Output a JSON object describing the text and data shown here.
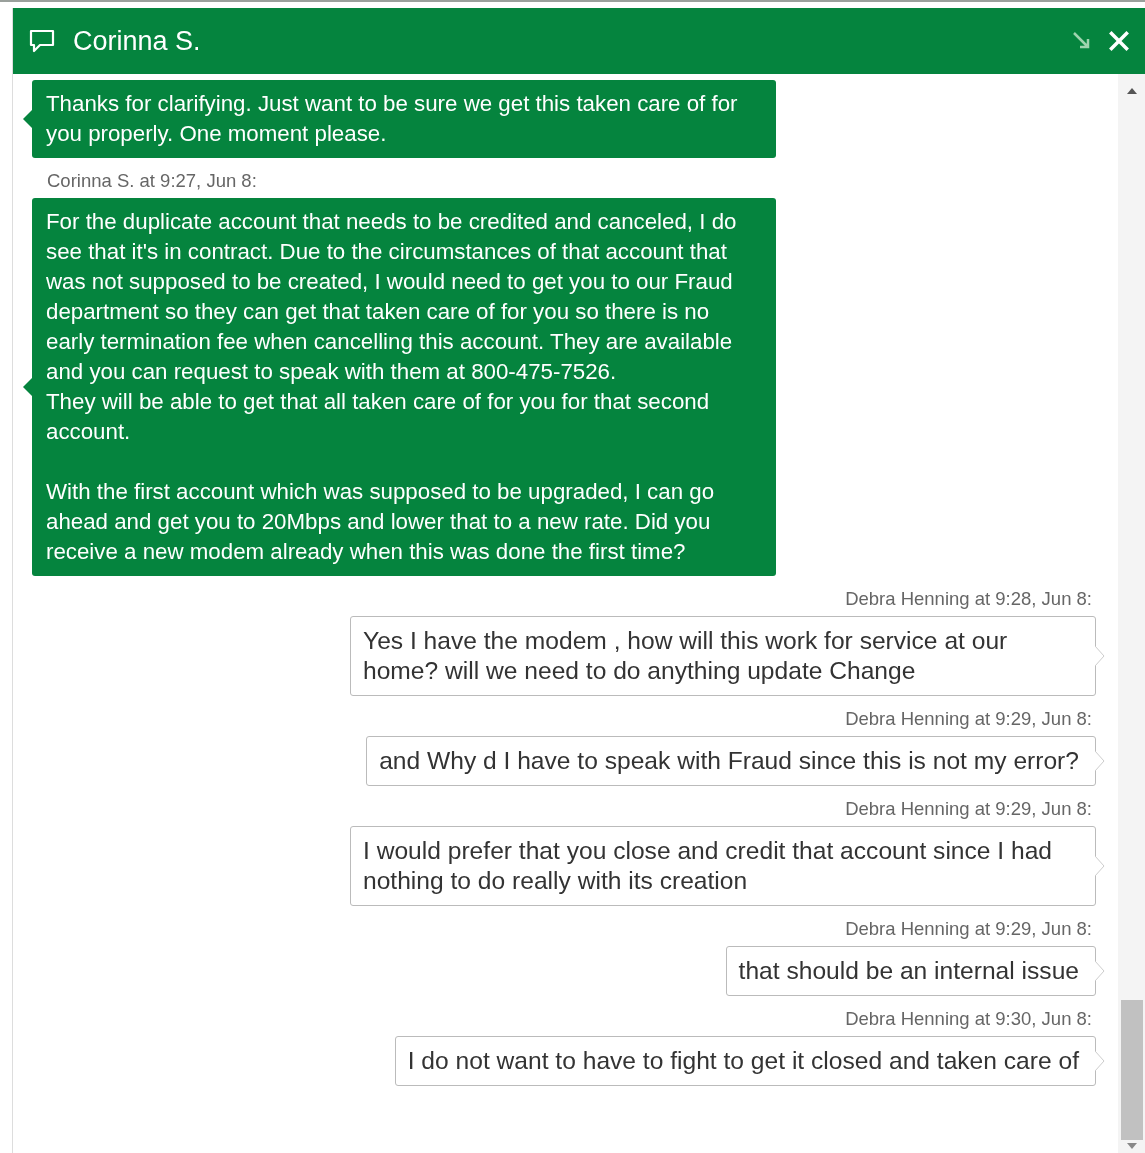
{
  "window": {
    "title": "Corinna S."
  },
  "messages": [
    {
      "kind": "agent",
      "text": "Thanks for clarifying. Just want to be sure we get this taken care of for you properly. One moment please."
    },
    {
      "kind": "agent",
      "meta": "Corinna S. at 9:27, Jun 8:",
      "text": "For the duplicate account that needs to be credited and canceled, I do see that it's in contract. Due to the circumstances of that account that was not supposed to be created, I would need to get you to our Fraud department so they can get that taken care of for you so there is no early termination fee when cancelling this account. They are available and you can request to speak with them at 800-475-7526.\nThey will be able to get that all taken care of for you for that second account.\n\nWith the first account which was supposed to be upgraded, I can go ahead and get you to 20Mbps and lower that to a new rate. Did you receive a new modem already when this was done the first time?"
    },
    {
      "kind": "customer",
      "meta": "Debra Henning at 9:28, Jun 8:",
      "text": "Yes I have the modem , how will this work for service at our home? will we need to do anything update Change"
    },
    {
      "kind": "customer",
      "meta": "Debra Henning at 9:29, Jun 8:",
      "text": "and Why d I have to speak with Fraud since this is not my error?"
    },
    {
      "kind": "customer",
      "meta": "Debra Henning at 9:29, Jun 8:",
      "text": "I would prefer that you close and credit that account since I had nothing to do really with its creation"
    },
    {
      "kind": "customer",
      "meta": "Debra Henning at 9:29, Jun 8:",
      "text": "that should be an internal issue"
    },
    {
      "kind": "customer",
      "meta": "Debra Henning at 9:30, Jun 8:",
      "text": "I do not want to have to fight to get it closed and taken care of"
    }
  ]
}
